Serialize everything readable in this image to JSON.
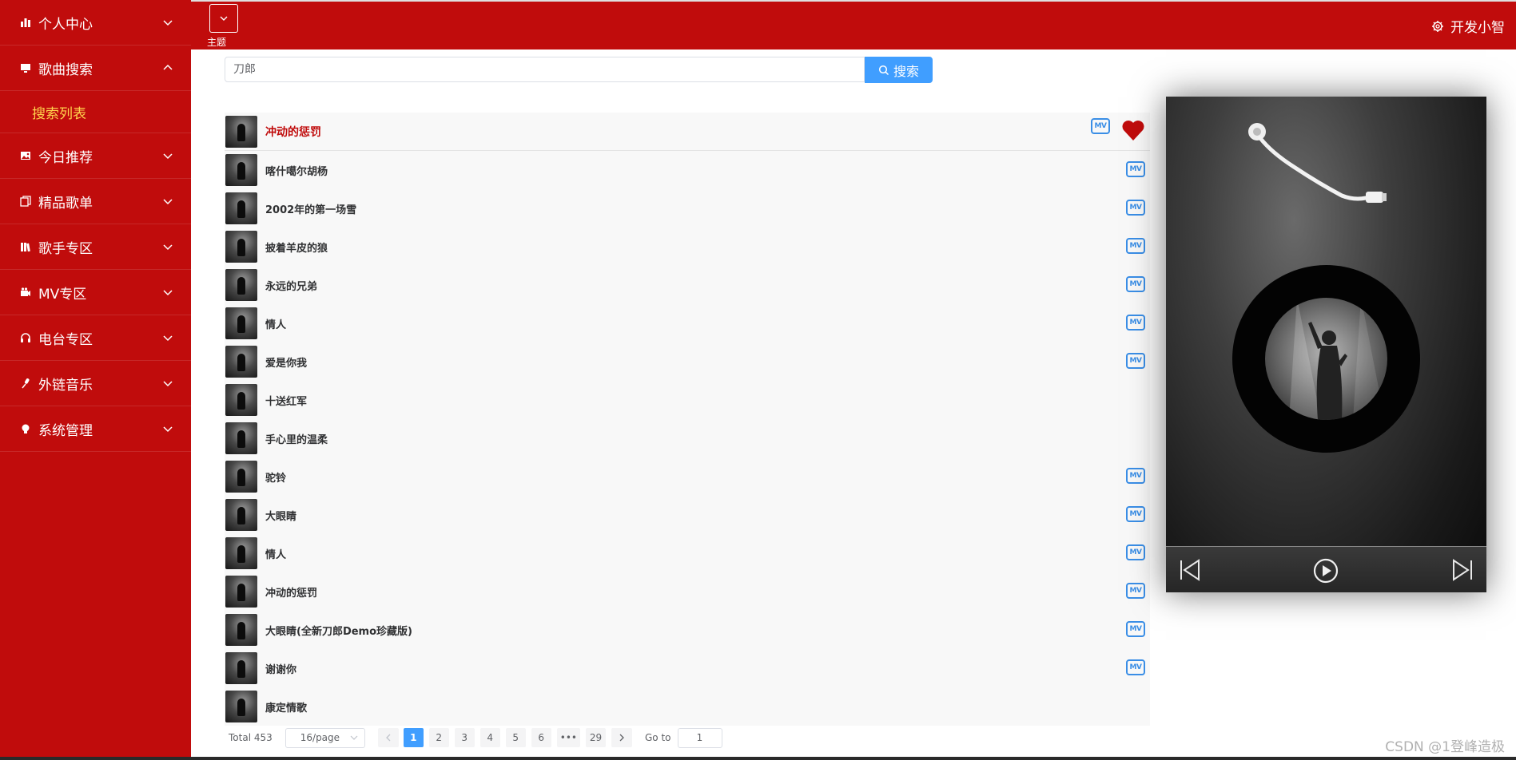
{
  "sidebar": {
    "items": [
      {
        "label": "个人中心",
        "icon": "bar-chart-icon",
        "expanded": false
      },
      {
        "label": "歌曲搜索",
        "icon": "monitor-icon",
        "expanded": true,
        "submenu": [
          {
            "label": "搜索列表",
            "active": true
          }
        ]
      },
      {
        "label": "今日推荐",
        "icon": "picture-icon",
        "expanded": false
      },
      {
        "label": "精品歌单",
        "icon": "copy-icon",
        "expanded": false
      },
      {
        "label": "歌手专区",
        "icon": "library-icon",
        "expanded": false
      },
      {
        "label": "MV专区",
        "icon": "camera-icon",
        "expanded": false
      },
      {
        "label": "电台专区",
        "icon": "headphones-icon",
        "expanded": false
      },
      {
        "label": "外链音乐",
        "icon": "microphone-icon",
        "expanded": false
      },
      {
        "label": "系统管理",
        "icon": "bulb-icon",
        "expanded": false
      }
    ]
  },
  "header": {
    "theme_label": "主题",
    "username": "开发小智"
  },
  "search": {
    "value": "刀郎",
    "button_label": "搜索"
  },
  "songs": [
    {
      "name": "冲动的惩罚",
      "mv": true,
      "liked": true,
      "active": true
    },
    {
      "name": "喀什噶尔胡杨",
      "mv": true
    },
    {
      "name": "2002年的第一场雪",
      "mv": true
    },
    {
      "name": "披着羊皮的狼",
      "mv": true
    },
    {
      "name": "永远的兄弟",
      "mv": true
    },
    {
      "name": "情人",
      "mv": true
    },
    {
      "name": "爱是你我",
      "mv": true
    },
    {
      "name": "十送红军",
      "mv": false
    },
    {
      "name": "手心里的温柔",
      "mv": false
    },
    {
      "name": "驼铃",
      "mv": true
    },
    {
      "name": "大眼睛",
      "mv": true
    },
    {
      "name": "情人",
      "mv": true
    },
    {
      "name": "冲动的惩罚",
      "mv": true
    },
    {
      "name": "大眼睛(全新刀郎Demo珍藏版)",
      "mv": true
    },
    {
      "name": "谢谢你",
      "mv": true
    },
    {
      "name": "康定情歌",
      "mv": false
    }
  ],
  "mv_label": "MV",
  "pagination": {
    "total_label": "Total 453",
    "page_size": "16/page",
    "pages": [
      "1",
      "2",
      "3",
      "4",
      "5",
      "6"
    ],
    "ellipsis": "•••",
    "last_page": "29",
    "current": "1",
    "goto_label": "Go to",
    "goto_value": "1"
  },
  "watermark": "CSDN @1登峰造极",
  "colors": {
    "brand_red": "#c00c0c",
    "active_submenu": "#ffd24d",
    "primary_blue": "#409eff",
    "mv_blue": "#3a8ee6"
  }
}
